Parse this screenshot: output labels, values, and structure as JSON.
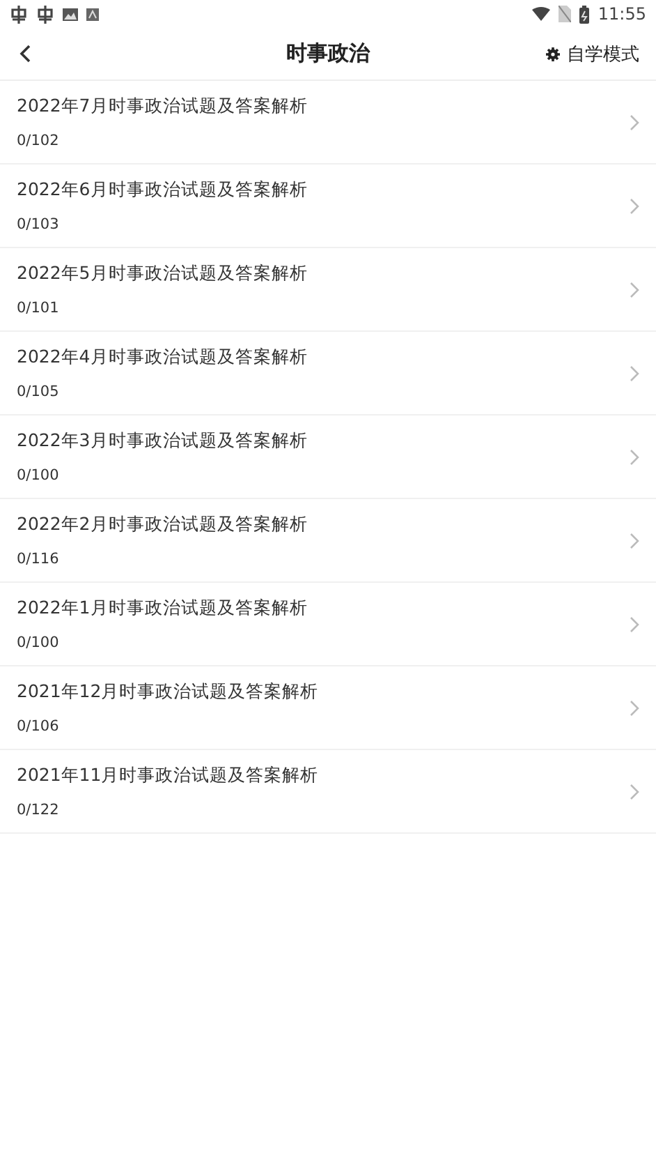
{
  "status_bar": {
    "time": "11:55"
  },
  "header": {
    "title": "时事政治",
    "mode_button": "自学模式"
  },
  "items": [
    {
      "title": "2022年7月时事政治试题及答案解析",
      "progress": "0/102"
    },
    {
      "title": "2022年6月时事政治试题及答案解析",
      "progress": "0/103"
    },
    {
      "title": "2022年5月时事政治试题及答案解析",
      "progress": "0/101"
    },
    {
      "title": "2022年4月时事政治试题及答案解析",
      "progress": "0/105"
    },
    {
      "title": "2022年3月时事政治试题及答案解析",
      "progress": "0/100"
    },
    {
      "title": "2022年2月时事政治试题及答案解析",
      "progress": "0/116"
    },
    {
      "title": "2022年1月时事政治试题及答案解析",
      "progress": "0/100"
    },
    {
      "title": "2021年12月时事政治试题及答案解析",
      "progress": "0/106"
    },
    {
      "title": "2021年11月时事政治试题及答案解析",
      "progress": "0/122"
    }
  ]
}
